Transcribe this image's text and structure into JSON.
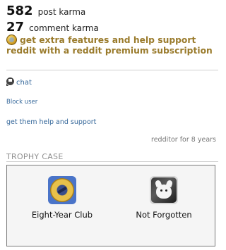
{
  "karma": {
    "post": {
      "value": "582",
      "label": "post karma"
    },
    "comment": {
      "value": "27",
      "label": "comment karma"
    }
  },
  "premium": {
    "icon": "reddit-gold-coin-icon",
    "text": "get extra features and help support reddit with a reddit premium subscription"
  },
  "links": {
    "chat": "chat",
    "chat_icon": "chat-bubble-icon",
    "block": "Block user",
    "help": "get them help and support"
  },
  "account_age": "redditor for 8 years",
  "trophy_case": {
    "title": "TROPHY CASE",
    "trophies": [
      {
        "name": "Eight-Year Club",
        "icon": "eight-year-club-trophy-icon"
      },
      {
        "name": "Not Forgotten",
        "icon": "not-forgotten-trophy-icon"
      }
    ]
  },
  "colors": {
    "premium_gold": "#9a7b2c",
    "link_blue": "#336699",
    "muted_gray": "#8f8f8f"
  }
}
